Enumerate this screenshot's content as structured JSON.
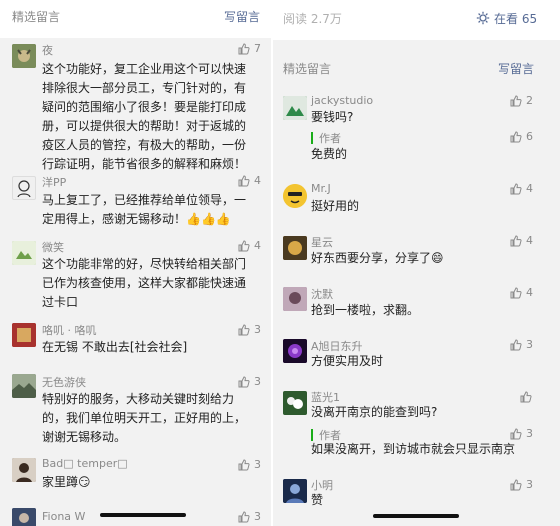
{
  "left": {
    "header": {
      "title": "精选留言",
      "write_label": "写留言"
    },
    "comments": [
      {
        "name": "夜",
        "likes": "7",
        "text": "这个功能好，复工企业用这个可以快速排除很大一部分员工，专门针对的，有疑问的范围缩小了很多！要是能打印成册，可以提供很大的帮助！对于返城的疫区人员的管控，有极大的帮助，一份行踪证明，能节省很多的解释和麻烦！",
        "avatar_color": "#7a8c5a"
      },
      {
        "name": "洋PP",
        "likes": "4",
        "text": "马上复工了，已经推荐给单位领导，一定用得上，感谢无锡移动！👍👍👍",
        "avatar_color": "#dcdcdc"
      },
      {
        "name": "微笑",
        "likes": "4",
        "text": "这个功能非常的好，尽快转给相关部门已作为核查使用，这样大家都能快速通过卡口",
        "avatar_color": "#8fb36a"
      },
      {
        "name": "咯叽 · 咯叽",
        "likes": "3",
        "text": "在无锡 不敢出去[社会社会]",
        "avatar_color": "#b23a3a"
      },
      {
        "name": "无色游侠",
        "likes": "3",
        "text": "特别好的服务，大移动关键时刻给力的，我们单位明天开工，正好用的上，谢谢无锡移动。",
        "avatar_color": "#6f7f6a"
      },
      {
        "name": "Bad□ temper□",
        "likes": "3",
        "text": "家里蹲😏",
        "avatar_color": "#6e5a4a"
      },
      {
        "name": "Fiona W",
        "likes": "3",
        "text": "",
        "avatar_color": "#3a4a6a"
      }
    ]
  },
  "right": {
    "top": {
      "reads_label": "阅读 2.7万",
      "watching_label": "在看 65"
    },
    "header": {
      "title": "精选留言",
      "write_label": "写留言"
    },
    "comments": [
      {
        "name": "jackystudio",
        "likes": "2",
        "text": "要钱吗?",
        "author_label": "作者",
        "author_reply": "免费的",
        "author_likes": "6",
        "avatar_color": "#1f7a3a"
      },
      {
        "name": "Mr.J",
        "likes": "4",
        "text": "挺好用的",
        "avatar_color": "#f3c430"
      },
      {
        "name": "星云",
        "likes": "4",
        "text": "好东西要分享，分享了😄",
        "avatar_color": "#b78a3c"
      },
      {
        "name": "沈默",
        "likes": "4",
        "text": "抢到一楼啦，求翻。",
        "avatar_color": "#8a6a8a"
      },
      {
        "name": "A旭日东升",
        "likes": "3",
        "text": "方便实用及时",
        "avatar_color": "#5a2a8a"
      },
      {
        "name": "蓝光1",
        "likes": "",
        "text": "没离开南京的能查到吗?",
        "author_label": "作者",
        "author_reply": "如果没离开，到访城市就会只显示南京",
        "author_likes": "3",
        "avatar_color": "#a8c8a0"
      },
      {
        "name": "小明",
        "likes": "3",
        "text": "赞",
        "avatar_color": "#3a5a9a"
      }
    ]
  },
  "colors": {
    "link": "#576b95",
    "muted": "#8a8a8a",
    "author_bar": "#1aad19"
  }
}
